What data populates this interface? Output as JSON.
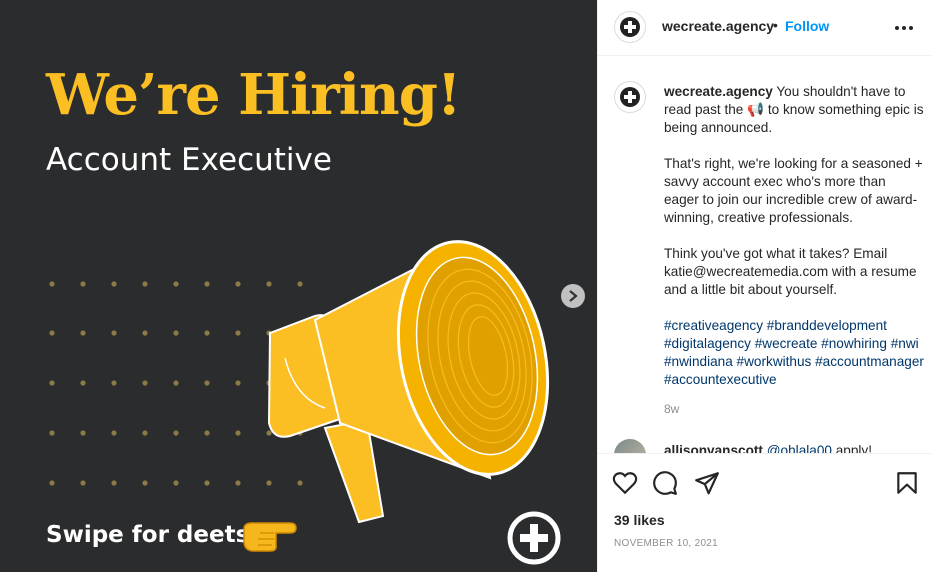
{
  "post_image": {
    "headline": "We’re Hiring!",
    "subhead": "Account Executive",
    "swipe_text": "Swipe for deets",
    "colors": {
      "background": "#2b2c2e",
      "accent": "#fbbf24",
      "dot": "#8a7a45"
    },
    "icons": {
      "megaphone": "megaphone-illustration",
      "hand": "pointing-hand-emoji",
      "logo": "wecreate-plus-logo",
      "next": "chevron-right-icon"
    }
  },
  "header": {
    "username": "wecreate.agency",
    "separator": "•",
    "follow_label": "Follow"
  },
  "caption": {
    "username": "wecreate.agency",
    "para1_before_emoji": "You shouldn't have to read past the",
    "para1_emoji": "📢",
    "para1_after_emoji": "to know something epic is being announced.",
    "para2": "That's right, we're looking for a seasoned + savvy account exec who's more than eager to join our incredible crew of award-winning, creative professionals.",
    "para3": "Think you've got what it takes? Email katie@wecreatemedia.com with a resume and a little bit about yourself.",
    "hashtags": "#creativeagency #branddevelopment #digitalagency #wecreate #nowhiring #nwi #nwindiana #workwithus #accountmanager #accountexecutive",
    "time": "8w"
  },
  "comment": {
    "username": "allisonvanscott",
    "mention": "@ohlala00",
    "text": "apply!"
  },
  "actions": {
    "likes": "39 likes",
    "date": "NOVEMBER 10, 2021"
  }
}
